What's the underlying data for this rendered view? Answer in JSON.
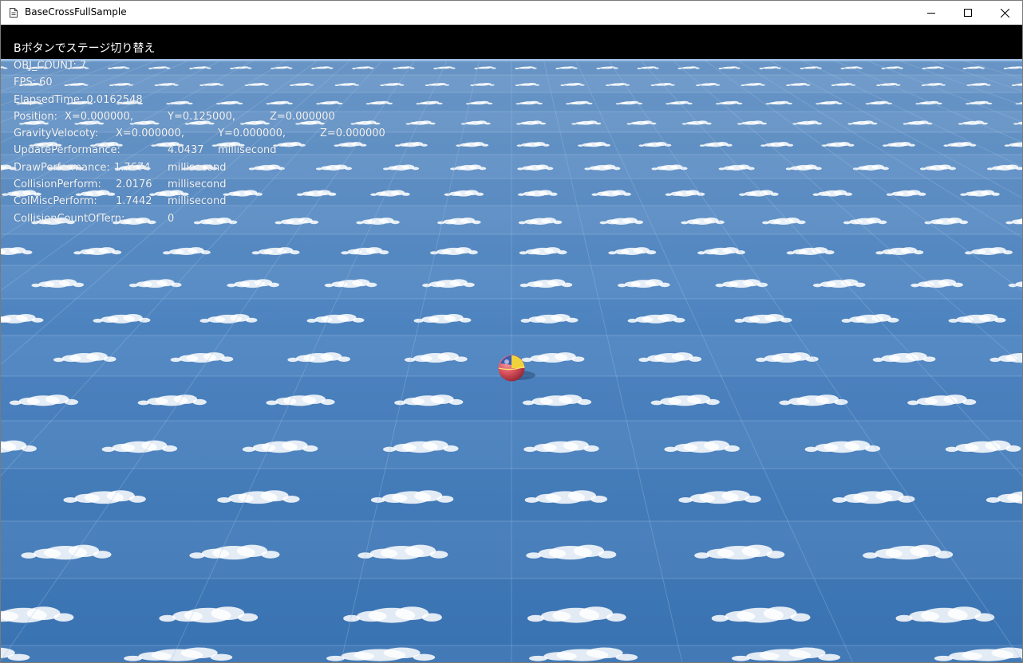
{
  "window": {
    "title": "BaseCrossFullSample",
    "controls": {
      "minimize": "minimize-icon",
      "maximize": "maximize-icon",
      "close": "close-icon"
    }
  },
  "hud": {
    "stage_hint": "Bボタンでステージ切り替え",
    "obj_count": "OBJ_COUNT: 7",
    "fps": "FPS: 60",
    "elapsed": "ElapsedTime: 0.0162548",
    "position": {
      "label": "Position:",
      "x": "X=0.000000,",
      "y": "Y=0.125000,",
      "z": "Z=0.000000"
    },
    "gravity_velocity": {
      "label": "GravityVelocoty:",
      "x": "X=0.000000,",
      "y": "Y=0.000000,",
      "z": "Z=0.000000"
    },
    "update_perf": {
      "label": "UpdatePerformance:",
      "value": "4.0437",
      "unit": "millisecond"
    },
    "draw_perf": {
      "label": "DrawPerformance:",
      "value": "1.7674",
      "unit": "millisecond"
    },
    "collision_perf": {
      "label": "CollisionPerform:",
      "value": "2.0176",
      "unit": "millisecond"
    },
    "colmisc_perf": {
      "label": "ColMiscPerform:",
      "value": "1.7442",
      "unit": "millisecond"
    },
    "collision_count": {
      "label": "CollisionCountOfTern:",
      "value": "0"
    }
  },
  "scene": {
    "sky_color": "#3f78b8",
    "cloud_color": "#ffffff",
    "ball_colors": [
      "#d8505a",
      "#f0d23c",
      "#3d5bb0"
    ]
  }
}
